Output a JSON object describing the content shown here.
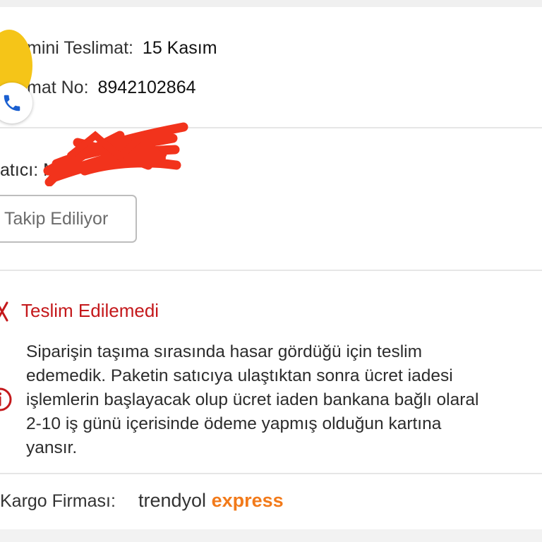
{
  "delivery": {
    "estimated_label": "mini Teslimat:",
    "estimated_value": "15 Kasım",
    "number_label": "mat No:",
    "number_value": "8942102864"
  },
  "seller": {
    "label": "atıcı: M",
    "follow_button": "Takip Ediliyor"
  },
  "status": {
    "title": "Teslim Edilemedi",
    "color": "#c4181b",
    "description_lines": [
      "Siparişin taşıma sırasında hasar gördüğü için teslim",
      "edemedik. Paketin satıcıya ulaştıktan sonra ücret iadesi",
      "işlemlerin başlayacak olup ücret iaden bankana bağlı olaral",
      "2-10 iş günü içerisinde ödeme yapmış olduğun kartına",
      "yansır."
    ]
  },
  "cargo": {
    "label": "Kargo Firması:",
    "brand_part1": "trendyol",
    "brand_part2": "express",
    "brand_color": "#f27a1a"
  },
  "icons": {
    "avatar": "store-avatar-icon",
    "phone": "phone-icon",
    "status": "close-x-icon",
    "info": "info-circle-icon"
  }
}
